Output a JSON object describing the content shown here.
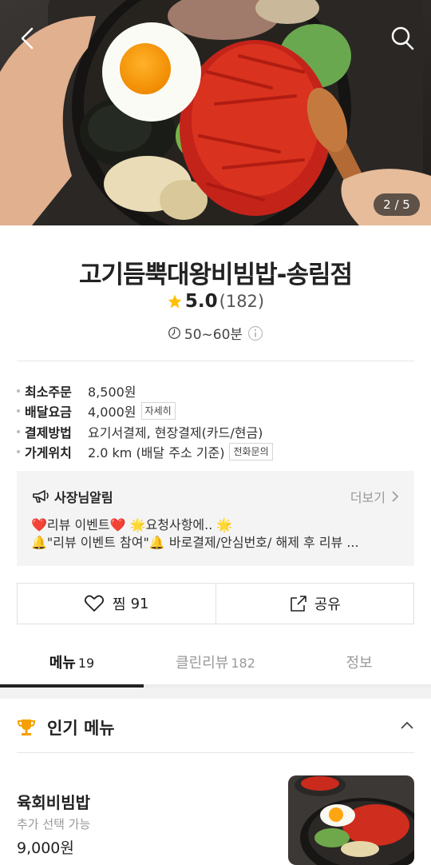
{
  "hero": {
    "page_counter": "2 / 5"
  },
  "store": {
    "name": "고기듬뿍대왕비빔밥-송림점",
    "rating": "5.0",
    "review_count": "(182)",
    "delivery_time": "50~60분"
  },
  "info": [
    {
      "label": "최소주문",
      "value": "8,500원"
    },
    {
      "label": "배달요금",
      "value": "4,000원",
      "button": "자세히"
    },
    {
      "label": "결제방법",
      "value": "요기서결제, 현장결제(카드/현금)"
    },
    {
      "label": "가게위치",
      "value": "2.0 km (배달 주소 기준)",
      "button": "전화문의"
    }
  ],
  "notice": {
    "title": "사장님알림",
    "more": "더보기",
    "line1": "❤️리뷰 이벤트❤️  🌟요청사항에..  🌟",
    "line2": "🔔\"리뷰 이벤트 참여\"🔔 바로결제/안심번호/ 해제 후  리뷰  ..."
  },
  "actions": {
    "like_label": "찜",
    "like_count": "91",
    "share_label": "공유"
  },
  "tabs": [
    {
      "label": "메뉴",
      "count": "19",
      "active": true
    },
    {
      "label": "클린리뷰",
      "count": "182",
      "active": false
    },
    {
      "label": "정보",
      "count": "",
      "active": false
    }
  ],
  "popular": {
    "title": "인기 메뉴",
    "item": {
      "name": "육회비빔밥",
      "option": "추가 선택 가능",
      "price": "9,000원"
    }
  },
  "colors": {
    "star": "#ffc107",
    "tab_active": "#222222",
    "notice_bg": "#f4f4f4"
  }
}
